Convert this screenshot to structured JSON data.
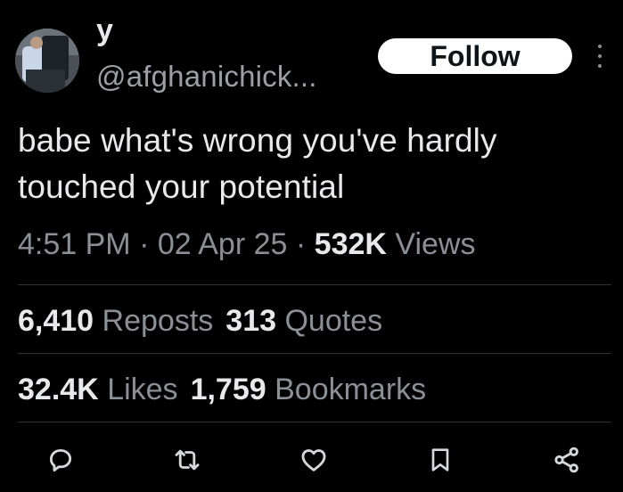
{
  "tweet": {
    "author": {
      "display_name": "y",
      "handle": "@afghanichick..."
    },
    "follow_label": "Follow",
    "text": "babe what's wrong you've hardly\ntouched your potential",
    "time": "4:51 PM",
    "date": "02 Apr 25",
    "separator": "·",
    "views_count": "532K",
    "views_label": "Views"
  },
  "stats": {
    "reposts": {
      "count": "6,410",
      "label": "Reposts"
    },
    "quotes": {
      "count": "313",
      "label": "Quotes"
    },
    "likes": {
      "count": "32.4K",
      "label": "Likes"
    },
    "bookmarks": {
      "count": "1,759",
      "label": "Bookmarks"
    }
  },
  "actions": [
    "reply-icon",
    "repost-icon",
    "like-icon",
    "bookmark-icon",
    "share-icon"
  ],
  "colors": {
    "background": "#000000",
    "primary_text": "#e7e9ea",
    "secondary_text": "#8b9096",
    "divider": "#2f3336",
    "follow_bg": "#ffffff"
  }
}
